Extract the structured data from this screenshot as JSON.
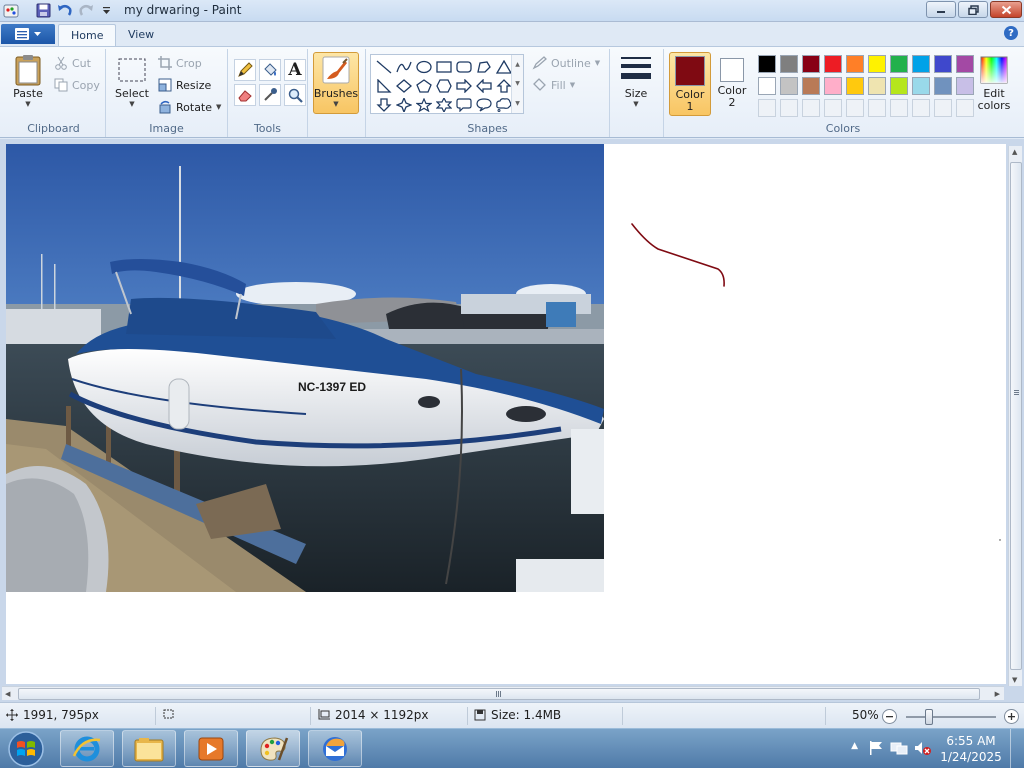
{
  "window": {
    "title": "my drwaring - Paint"
  },
  "tabs": [
    {
      "label": "Home",
      "active": true
    },
    {
      "label": "View",
      "active": false
    }
  ],
  "ribbon": {
    "clipboard": {
      "label": "Clipboard",
      "paste": "Paste",
      "cut": "Cut",
      "copy": "Copy"
    },
    "image": {
      "label": "Image",
      "select": "Select",
      "crop": "Crop",
      "resize": "Resize",
      "rotate": "Rotate"
    },
    "tools": {
      "label": "Tools"
    },
    "brushes": {
      "label": "Brushes"
    },
    "shapes": {
      "label": "Shapes",
      "outline": "Outline",
      "fill": "Fill"
    },
    "size": {
      "label": "Size"
    },
    "colors": {
      "label": "Colors",
      "color1_line1": "Color",
      "color1_line2": "1",
      "color2_line1": "Color",
      "color2_line2": "2",
      "edit_line1": "Edit",
      "edit_line2": "colors",
      "color1_value": "#7f0a12",
      "color2_value": "#ffffff",
      "palette_row1": [
        "#000000",
        "#7f7f7f",
        "#880015",
        "#ed1c24",
        "#ff7f27",
        "#fff200",
        "#22b14c",
        "#00a2e8",
        "#3f48cc",
        "#a349a4"
      ],
      "palette_row2": [
        "#ffffff",
        "#c3c3c3",
        "#b97a57",
        "#ffaec9",
        "#ffc90e",
        "#efe4b0",
        "#b5e61d",
        "#99d9ea",
        "#7092be",
        "#c8bfe7"
      ]
    }
  },
  "canvas": {
    "photo_registration": "NC-1397 ED",
    "stroke_color": "#7f0a12"
  },
  "statusbar": {
    "cursor_position": "1991, 795px",
    "image_dimensions": "2014 × 1192px",
    "file_size": "Size: 1.4MB",
    "zoom": "50%"
  },
  "taskbar": {
    "time": "6:55 AM",
    "date": "1/24/2025"
  }
}
